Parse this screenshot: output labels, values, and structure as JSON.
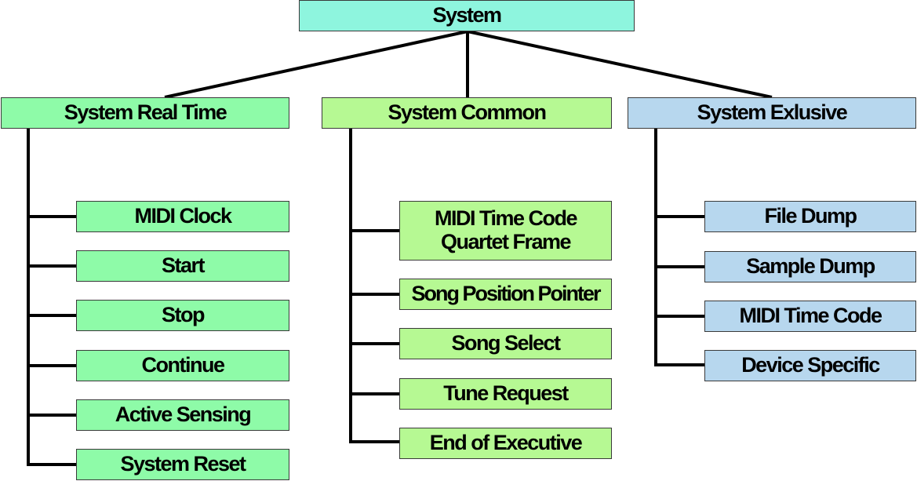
{
  "diagram": {
    "root": {
      "label": "System",
      "color": "#8ef5de"
    },
    "categories": [
      {
        "label": "System Real Time",
        "color": "#8efba8",
        "children": [
          "MIDI Clock",
          "Start",
          "Stop",
          "Continue",
          "Active Sensing",
          "System Reset"
        ]
      },
      {
        "label": "System Common",
        "color": "#b6f993",
        "children": [
          "MIDI Time Code\nQuartet Frame",
          "Song Position Pointer",
          "Song Select",
          "Tune Request",
          "End of Executive"
        ]
      },
      {
        "label": "System Exlusive",
        "color": "#b7d7ee",
        "children": [
          "File Dump",
          "Sample Dump",
          "MIDI Time Code",
          "Device Specific"
        ]
      }
    ],
    "line_color": "#000000"
  }
}
